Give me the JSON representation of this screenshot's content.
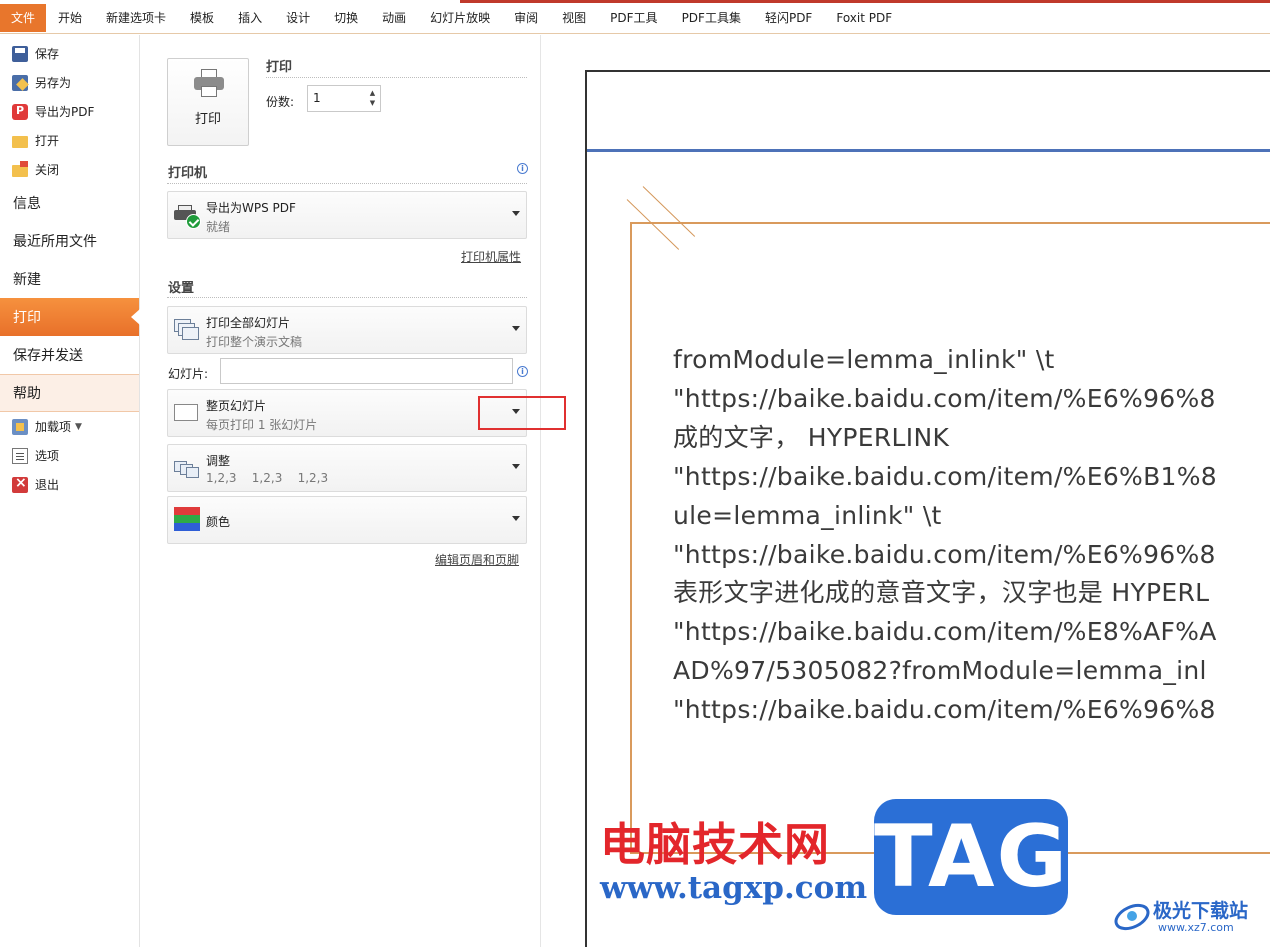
{
  "ribbon": {
    "tabs": [
      "文件",
      "开始",
      "新建选项卡",
      "模板",
      "插入",
      "设计",
      "切换",
      "动画",
      "幻灯片放映",
      "审阅",
      "视图",
      "PDF工具",
      "PDF工具集",
      "轻闪PDF",
      "Foxit PDF"
    ]
  },
  "nav": {
    "save": "保存",
    "save_as": "另存为",
    "export_pdf": "导出为PDF",
    "open": "打开",
    "close": "关闭",
    "info": "信息",
    "recent": "最近所用文件",
    "new": "新建",
    "print": "打印",
    "save_send": "保存并发送",
    "help": "帮助",
    "addins": "加载项",
    "options": "选项",
    "exit": "退出"
  },
  "print": {
    "button_label": "打印",
    "section_title": "打印",
    "copies_label": "份数:",
    "copies_value": "1"
  },
  "printer": {
    "section_title": "打印机",
    "name": "导出为WPS PDF",
    "status": "就绪",
    "properties_link": "打印机属性"
  },
  "settings": {
    "section_title": "设置",
    "range_title": "打印全部幻灯片",
    "range_sub": "打印整个演示文稿",
    "slides_label": "幻灯片:",
    "slides_value": "",
    "layout_title": "整页幻灯片",
    "layout_sub": "每页打印 1 张幻灯片",
    "collate_title": "调整",
    "collate_sub": "1,2,3    1,2,3    1,2,3",
    "color_title": "颜色",
    "header_footer_link": "编辑页眉和页脚"
  },
  "preview": {
    "lines": [
      "fromModule=lemma_inlink\" \\t",
      "\"https://baike.baidu.com/item/%E6%96%8",
      "成的文字， HYPERLINK",
      "\"https://baike.baidu.com/item/%E6%B1%8",
      "ule=lemma_inlink\" \\t",
      "\"https://baike.baidu.com/item/%E6%96%8",
      "表形文字进化成的意音文字，汉字也是 HYPERL",
      "\"https://baike.baidu.com/item/%E8%AF%A",
      "AD%97/5305082?fromModule=lemma_inl",
      "\"https://baike.baidu.com/item/%E6%96%8"
    ]
  },
  "watermark": {
    "site_cn": "电脑技术网",
    "site_url": "www.tagxp.com",
    "tag": "TAG",
    "xz_name": "极光下载站",
    "xz_url": "www.xz7.com"
  },
  "colors": {
    "file_tab": "#e8762c",
    "active_nav": "#f08a3a",
    "highlight_box": "#e03030",
    "frame": "#d99a5c",
    "rule": "#4d72b8"
  }
}
